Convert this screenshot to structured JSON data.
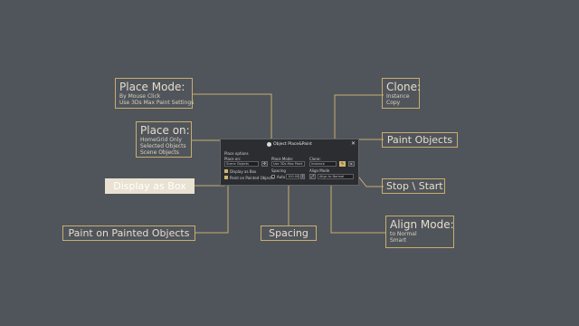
{
  "callouts": {
    "place_mode": {
      "title": "Place Mode:",
      "lines": [
        "By Mouse Click",
        "Use 3Ds Max Paint Settings"
      ]
    },
    "place_on": {
      "title": "Place on:",
      "lines": [
        "HomeGrid Only",
        "Selected Objects",
        "Scene Objects"
      ]
    },
    "display_as_box": {
      "title": "Display as Box"
    },
    "paint_on_painted": {
      "title": "Paint on Painted Objects"
    },
    "spacing": {
      "title": "Spacing"
    },
    "clone": {
      "title": "Clone:",
      "lines": [
        "Instance",
        "Copy"
      ]
    },
    "paint_objects": {
      "title": "Paint Objects"
    },
    "stop_start": {
      "title": "Stop \\ Start"
    },
    "align_mode": {
      "title": "Align Mode:",
      "lines": [
        "to Normal",
        "Smart"
      ]
    }
  },
  "dialog": {
    "title": "Object Place&Paint",
    "close": "✕",
    "place_options": "Place options",
    "place_on_label": "Place on:",
    "place_on_value": "Scene Objects",
    "place_mode_label": "Place Mode:",
    "place_mode_value": "Use 3Ds Max Paint",
    "clone_label": "Clone:",
    "clone_value": "Instance",
    "display_as_box": "Display as Box",
    "paint_on_painted": "Paint on Painted Objects",
    "spacing_label": "Spacing",
    "auto_label": "Auto",
    "spacing_value": "100.00",
    "align_mode_label": "Align Mode",
    "align_mode_value": "Align to Normal"
  },
  "colors": {
    "accent": "#c9ad6f",
    "background": "#50555b",
    "dialog": "#2b2d30"
  }
}
